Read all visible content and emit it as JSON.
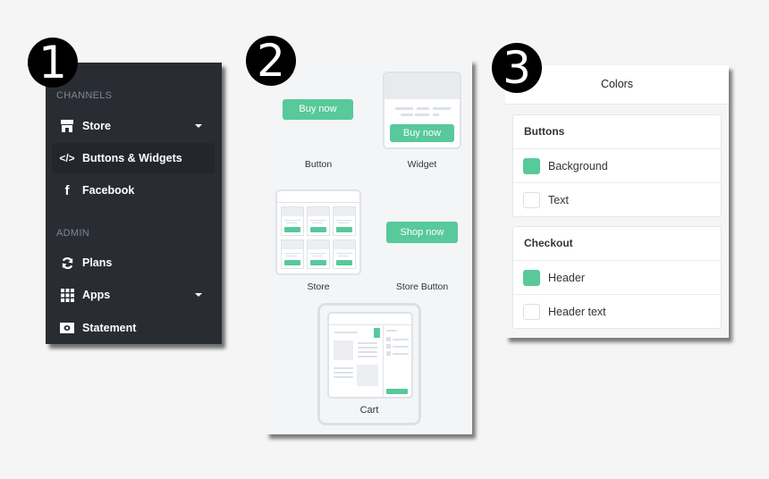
{
  "badges": [
    "1",
    "2",
    "3"
  ],
  "sidebar": {
    "sections": [
      {
        "title": "CHANNELS",
        "items": [
          {
            "label": "Store",
            "icon": "store-icon",
            "has_caret": true
          },
          {
            "label": "Buttons & Widgets",
            "icon": "code-icon",
            "active": true
          },
          {
            "label": "Facebook",
            "icon": "facebook-icon"
          }
        ]
      },
      {
        "title": "ADMIN",
        "items": [
          {
            "label": "Plans",
            "icon": "refresh-icon"
          },
          {
            "label": "Apps",
            "icon": "grid-icon",
            "has_caret": true
          },
          {
            "label": "Statement",
            "icon": "money-icon"
          }
        ]
      }
    ]
  },
  "widgets": {
    "button": {
      "preview_label": "Buy now",
      "caption": "Button"
    },
    "widget": {
      "preview_label": "Buy now",
      "caption": "Widget"
    },
    "store": {
      "caption": "Store"
    },
    "store_button": {
      "preview_label": "Shop now",
      "caption": "Store Button"
    },
    "cart": {
      "caption": "Cart"
    }
  },
  "colors": {
    "title": "Colors",
    "accent": "#57c99a",
    "groups": [
      {
        "title": "Buttons",
        "rows": [
          {
            "label": "Background",
            "color": "#57c99a"
          },
          {
            "label": "Text",
            "color": "#ffffff"
          }
        ]
      },
      {
        "title": "Checkout",
        "rows": [
          {
            "label": "Header",
            "color": "#57c99a"
          },
          {
            "label": "Header text",
            "color": "#ffffff"
          }
        ]
      }
    ]
  }
}
